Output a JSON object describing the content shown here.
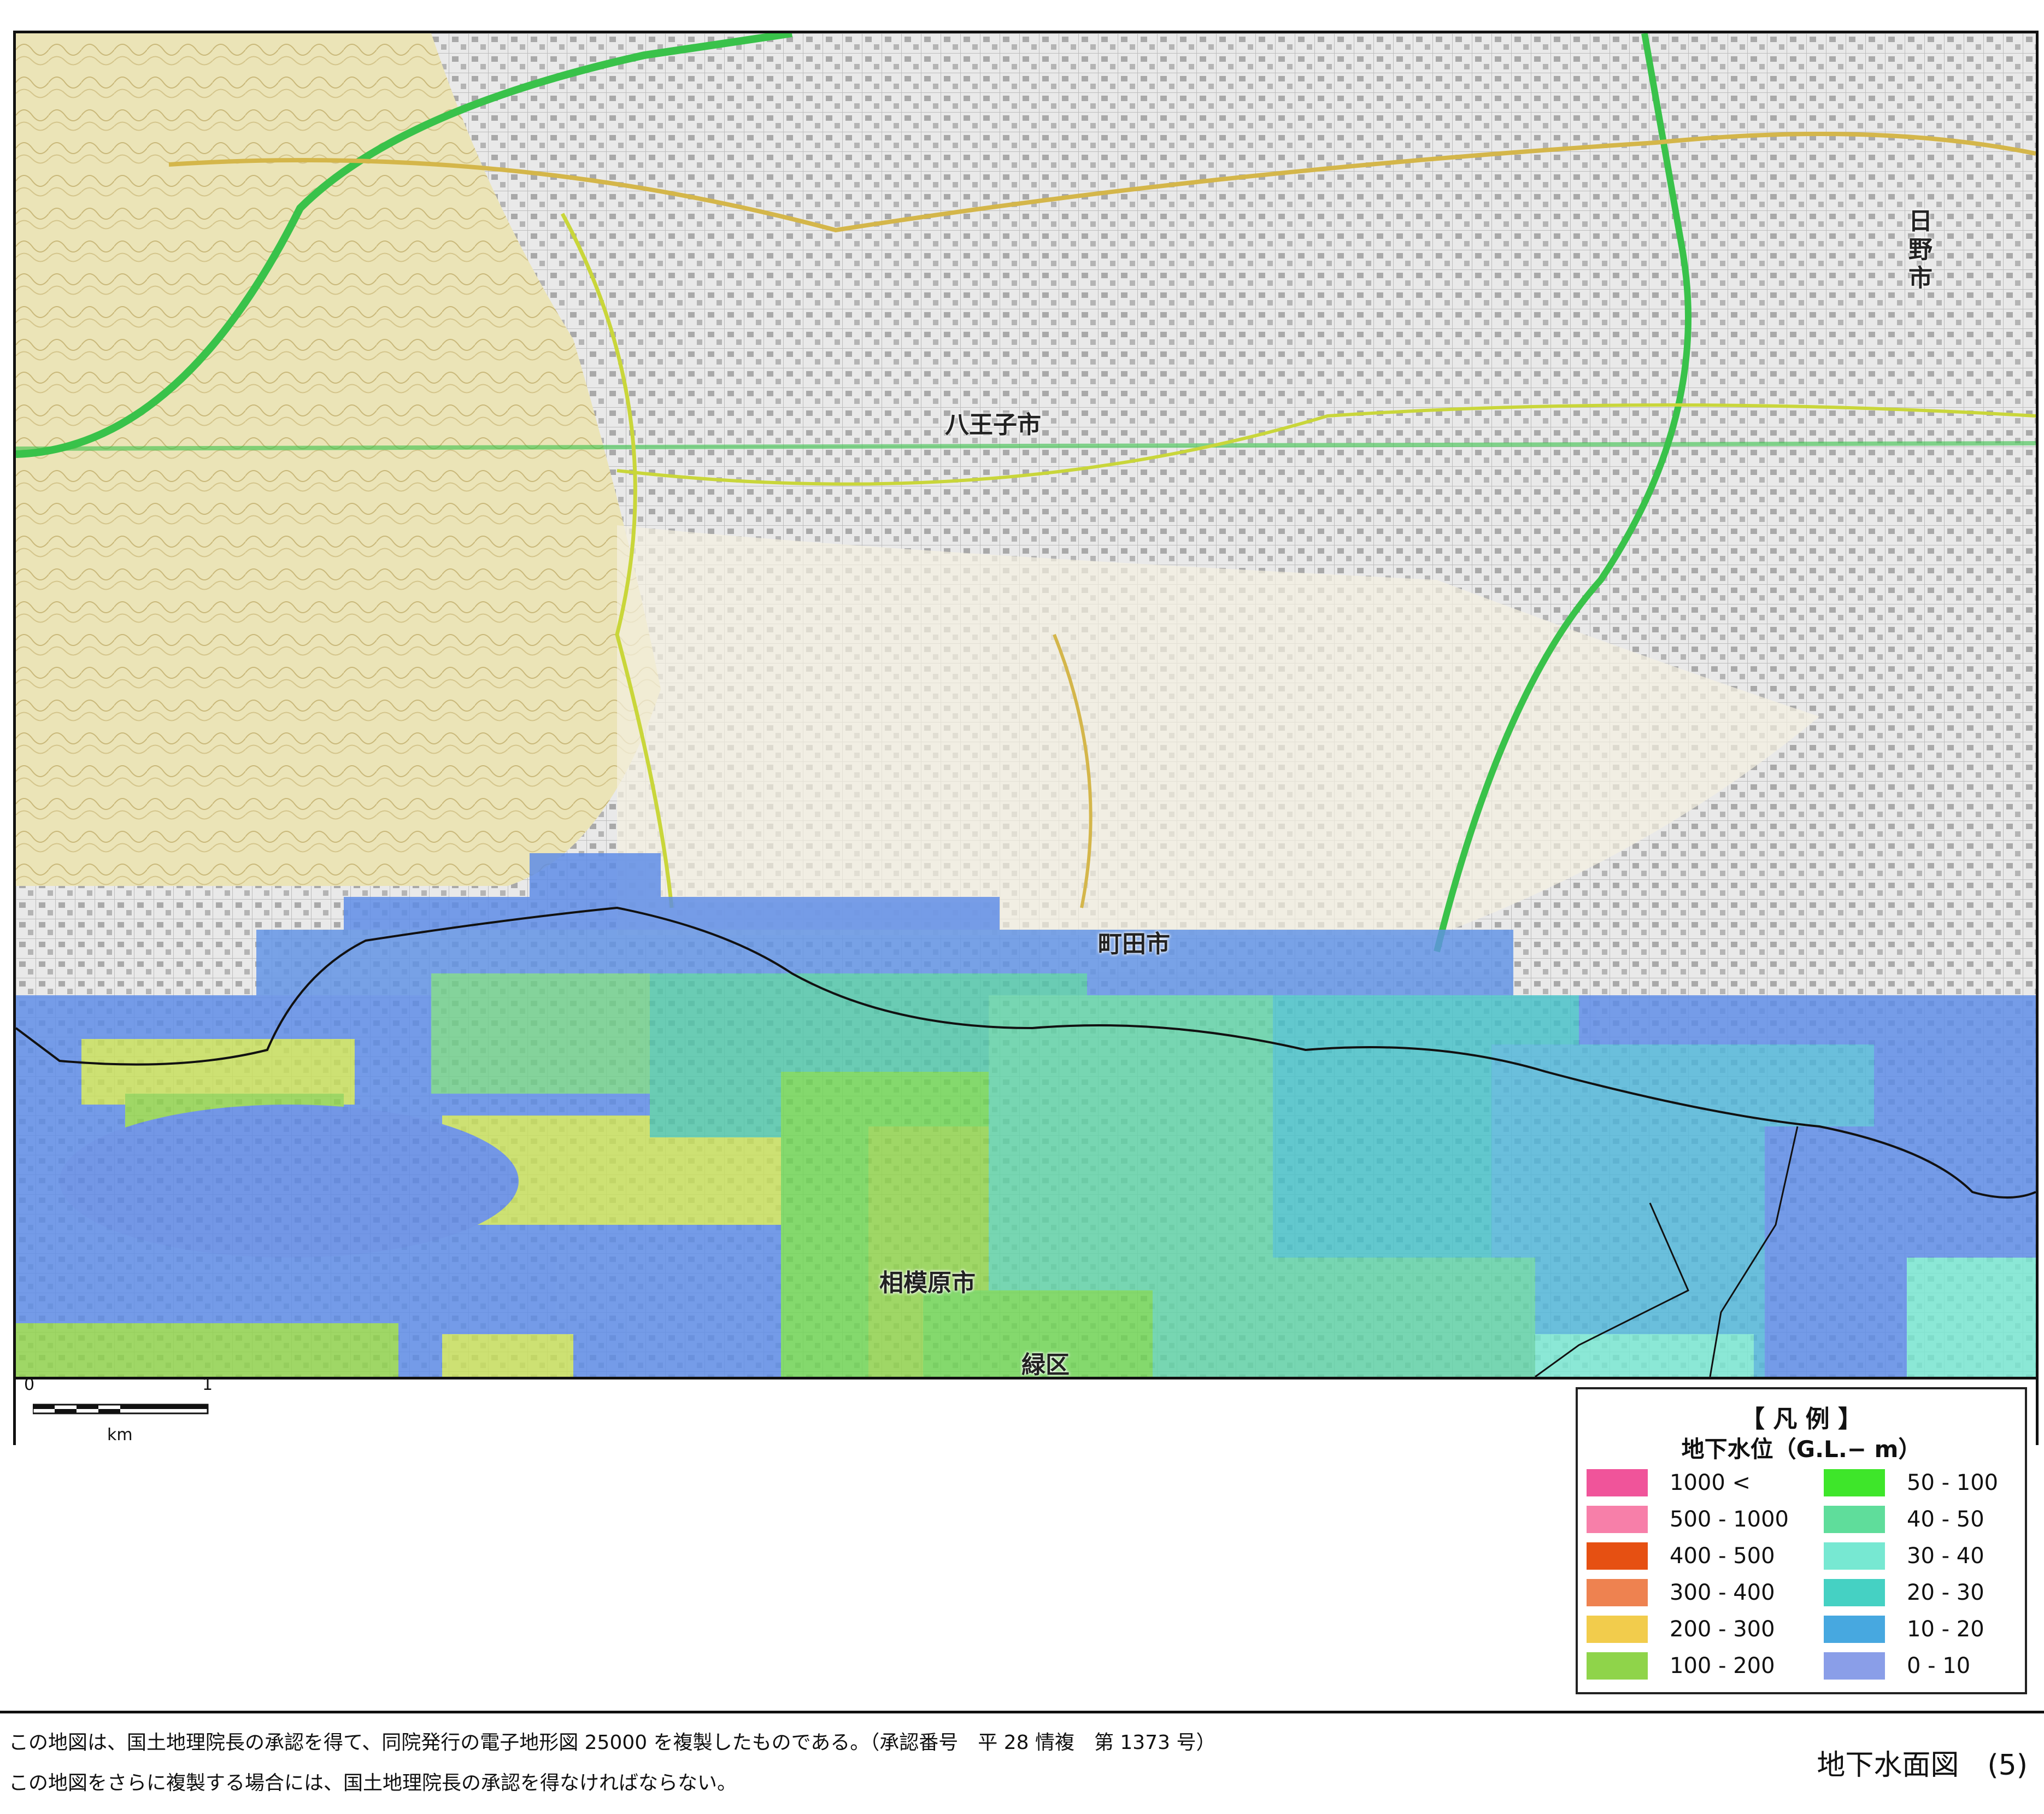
{
  "map": {
    "place_names": {
      "hachioji": "八王子市",
      "hino": "日野市",
      "machida": "町田市",
      "sagamihara": "相模原市",
      "midori": "緑区"
    }
  },
  "scale": {
    "start": "0",
    "end": "1",
    "unit": "km"
  },
  "legend": {
    "title": "【 凡 例 】",
    "subtitle": "地下水位（G.L.− m）",
    "left_items": [
      {
        "label": "1000 <",
        "color": "#f0549a"
      },
      {
        "label": "500 - 1000",
        "color": "#f77fa9"
      },
      {
        "label": "400 - 500",
        "color": "#e65012"
      },
      {
        "label": "300 - 400",
        "color": "#ee8250"
      },
      {
        "label": "200 - 300",
        "color": "#f2cc4c"
      },
      {
        "label": "100 - 200",
        "color": "#8fd44a"
      }
    ],
    "right_items": [
      {
        "label": "50 - 100",
        "color": "#3ee62a"
      },
      {
        "label": "40 - 50",
        "color": "#5fdd9b"
      },
      {
        "label": "30 - 40",
        "color": "#77e8d2"
      },
      {
        "label": "20 - 30",
        "color": "#45d1c3"
      },
      {
        "label": "10 - 20",
        "color": "#47a8e0"
      },
      {
        "label": "0 - 10",
        "color": "#8a9ee8"
      }
    ]
  },
  "footer": {
    "note1": "この地図は、国土地理院長の承認を得て、同院発行の電子地形図 25000 を複製したものである。（承認番号　平 28 情複　第 1373 号）",
    "note2": "この地図をさらに複製する場合には、国土地理院長の承認を得なければならない。",
    "figure_title": "地下水面図　(5)"
  }
}
